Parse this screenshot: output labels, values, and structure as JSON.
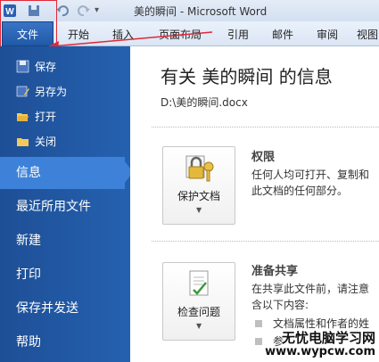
{
  "titlebar": {
    "title": "美的瞬间 - Microsoft Word"
  },
  "ribbon": {
    "file_tab": "文件",
    "tabs": [
      "开始",
      "插入",
      "页面布局",
      "引用",
      "邮件",
      "审阅",
      "视图"
    ]
  },
  "sidebar": {
    "small_items": [
      "保存",
      "另存为",
      "打开",
      "关闭"
    ],
    "big_items": [
      "信息",
      "最近所用文件",
      "新建",
      "打印",
      "保存并发送",
      "帮助"
    ],
    "active": "信息"
  },
  "info": {
    "title": "有关 美的瞬间 的信息",
    "path": "D:\\美的瞬间.docx",
    "permissions": {
      "button": "保护文档",
      "heading": "权限",
      "lines": [
        "任何人均可打开、复制和",
        "此文档的任何部分。"
      ]
    },
    "prepare": {
      "button": "检查问题",
      "heading": "准备共享",
      "lines": [
        "在共享此文件前，请注意",
        "含以下内容:"
      ],
      "bullets": [
        "文档属性和作者的姓",
        "参"
      ]
    }
  },
  "watermark": {
    "line1": "无忧电脑学习网",
    "line2": "www.wypcw.com"
  },
  "colors": {
    "annotation": "#e0283a",
    "sidebar": "#2561b0",
    "active": "#3d82d8"
  }
}
